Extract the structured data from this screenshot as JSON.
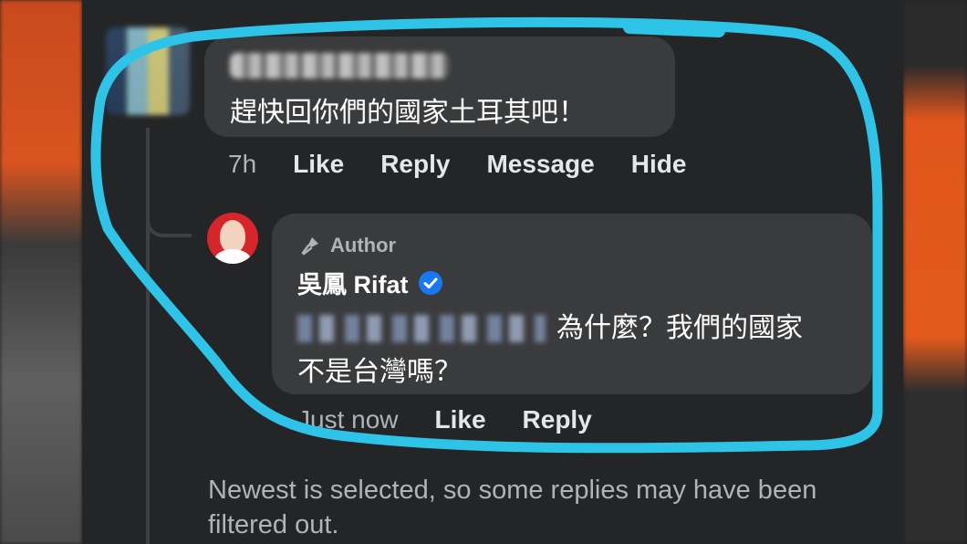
{
  "comment": {
    "text": "趕快回你們的國家土耳其吧！",
    "time": "7h",
    "actions": {
      "like": "Like",
      "reply": "Reply",
      "message": "Message",
      "hide": "Hide"
    }
  },
  "reply": {
    "badge": "Author",
    "author": "吳鳳 Rifat",
    "text_line1": "為什麼？我們的國家",
    "text_line2": "不是台灣嗎？",
    "time": "Just now",
    "actions": {
      "like": "Like",
      "reply": "Reply"
    }
  },
  "notice": "Newest is selected, so some replies may have been filtered out.",
  "colors": {
    "background": "#242526",
    "bubble": "#3a3b3c",
    "secondary_text": "#b0b3b8",
    "highlight": "#2ec4e8",
    "verified": "#1877f2"
  }
}
